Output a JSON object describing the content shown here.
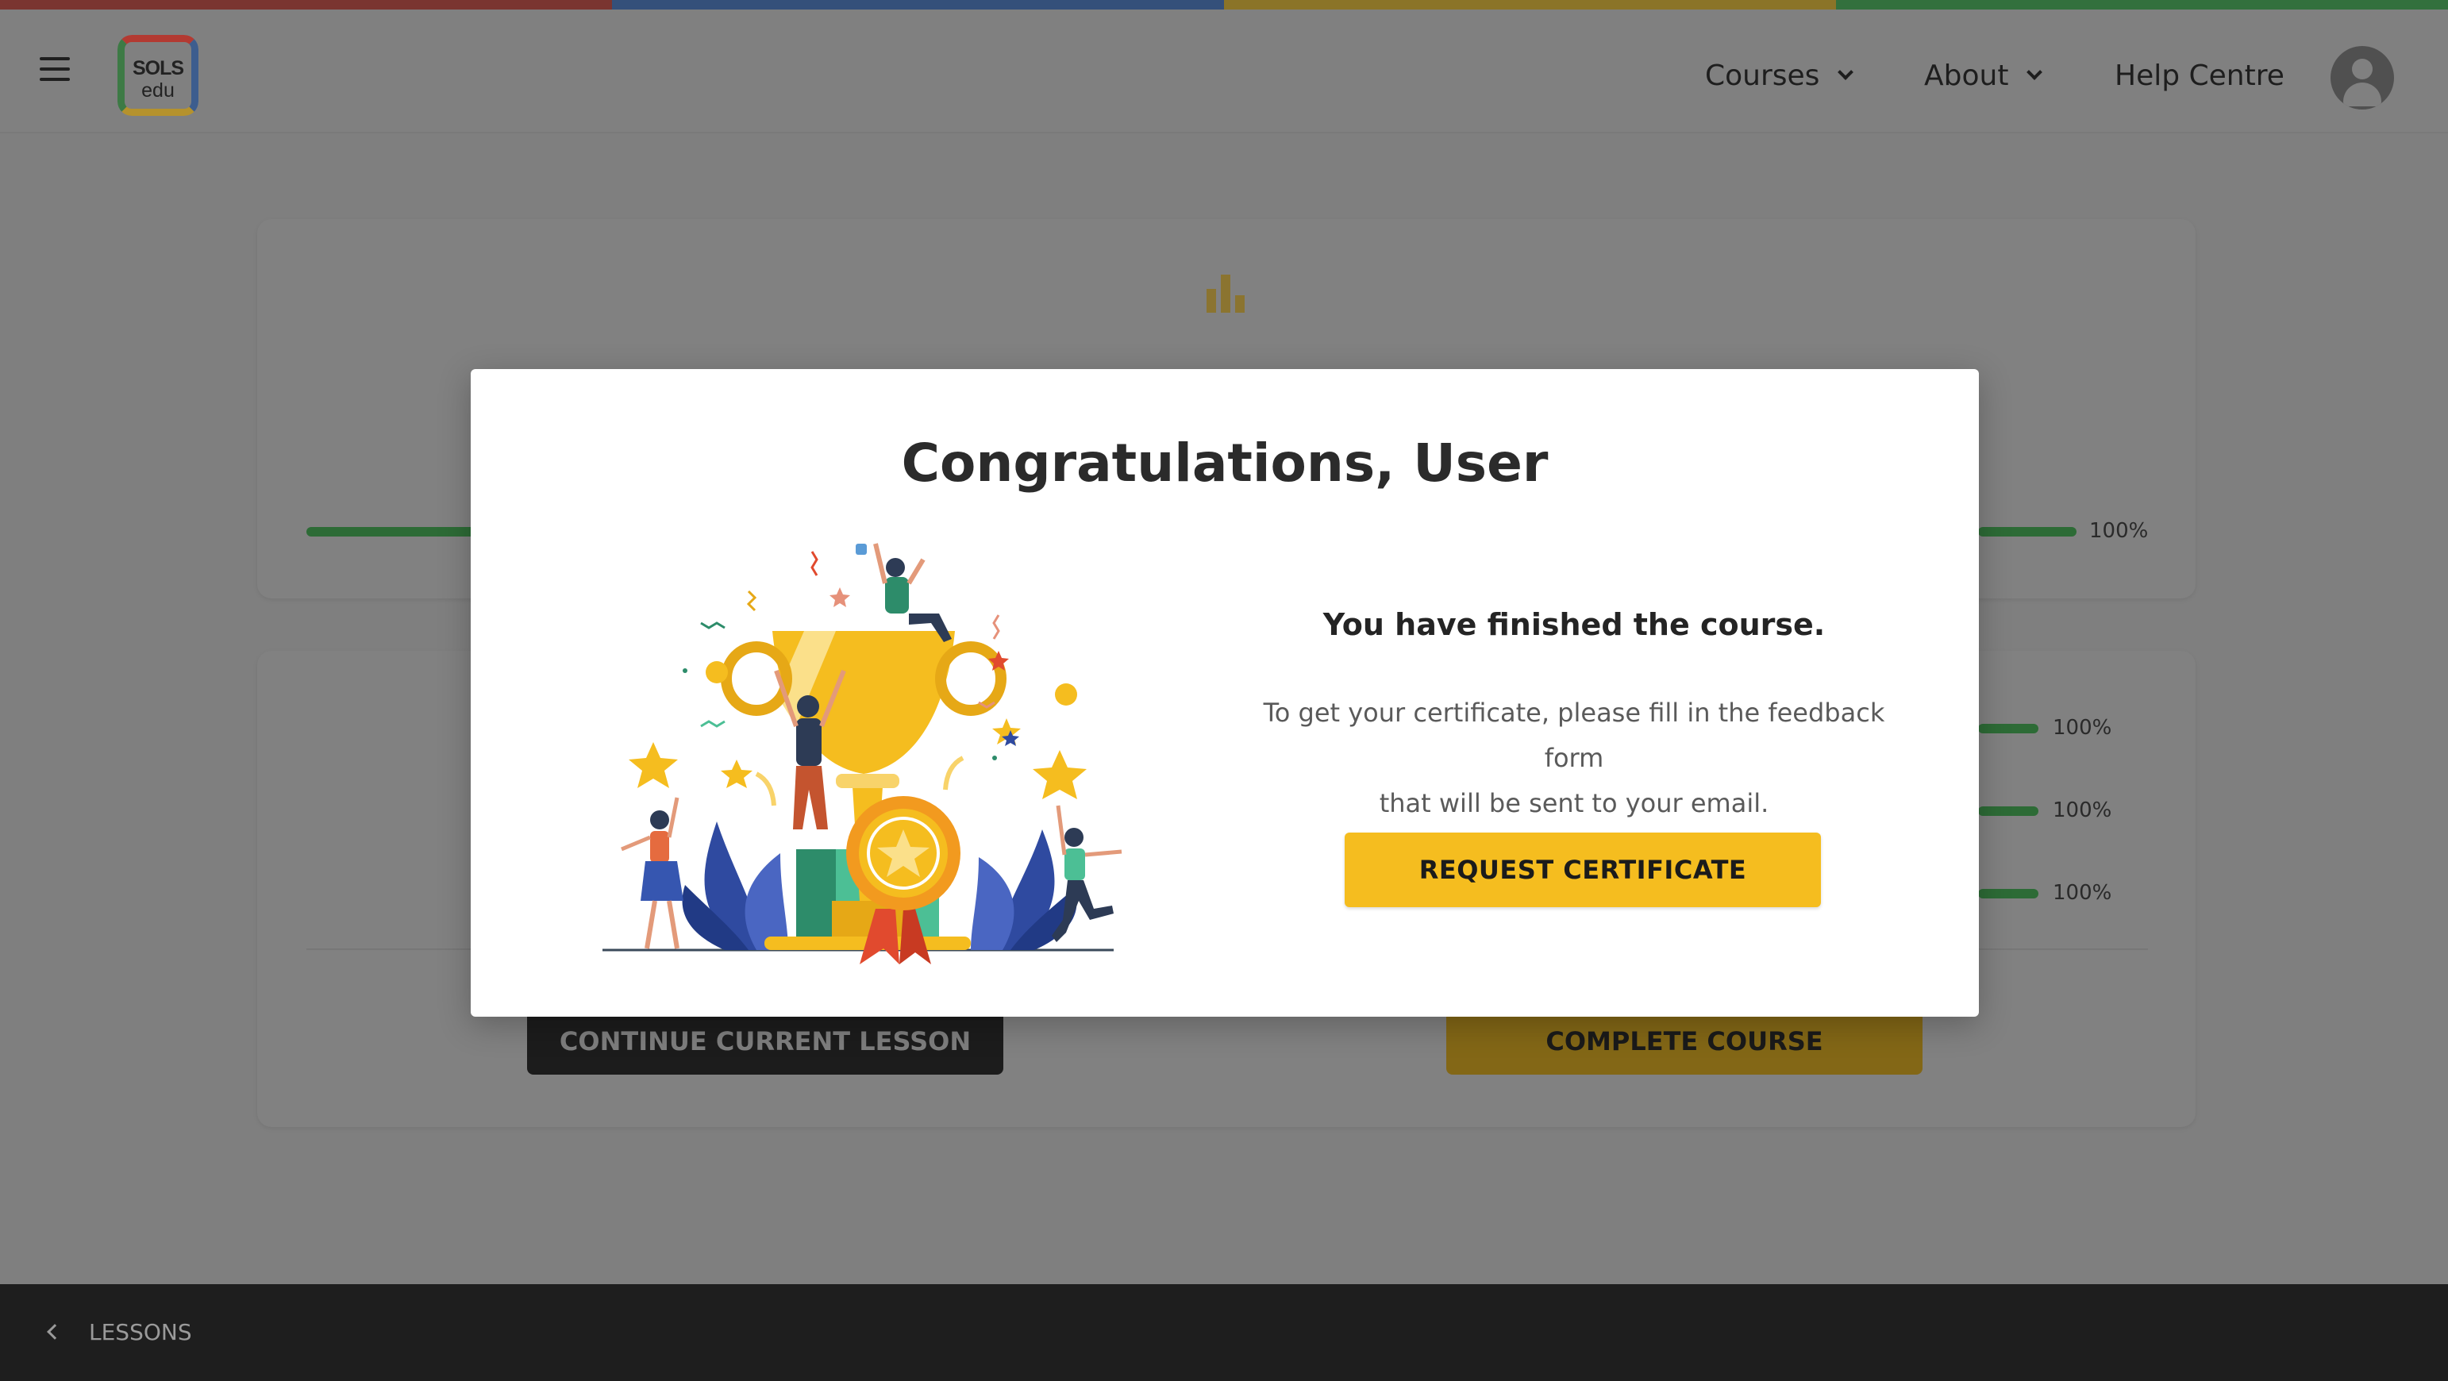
{
  "brand": {
    "strip_colors": [
      "#c0392b",
      "#2f5aa8",
      "#f1c40f",
      "#2e8b3e"
    ],
    "logo_top": "SOLS",
    "logo_bottom": "edu",
    "accent": "#f5bd1f"
  },
  "header": {
    "nav": [
      {
        "label": "Courses",
        "has_dropdown": true
      },
      {
        "label": "About",
        "has_dropdown": true
      },
      {
        "label": "Help Centre",
        "has_dropdown": false
      }
    ]
  },
  "progress": {
    "overall_label": "100%",
    "overall_value": 100,
    "lessons": [
      {
        "label": "100%",
        "value": 100
      },
      {
        "label": "100%",
        "value": 100
      },
      {
        "label": "100%",
        "value": 100
      }
    ]
  },
  "actions": {
    "continue_label": "CONTINUE CURRENT LESSON",
    "complete_label": "COMPLETE COURSE"
  },
  "modal": {
    "title": "Congratulations, User",
    "heading": "You have finished the course.",
    "body_line1": "To get your certificate, please fill in the feedback form",
    "body_line2": "that will be sent to your email.",
    "button_label": "REQUEST CERTIFICATE"
  },
  "footer": {
    "back_label": "LESSONS"
  },
  "icons": [
    "menu-icon",
    "bar-chart-icon",
    "chevron-down-icon",
    "user-avatar-icon",
    "chevron-left-icon",
    "trophy-illustration"
  ]
}
